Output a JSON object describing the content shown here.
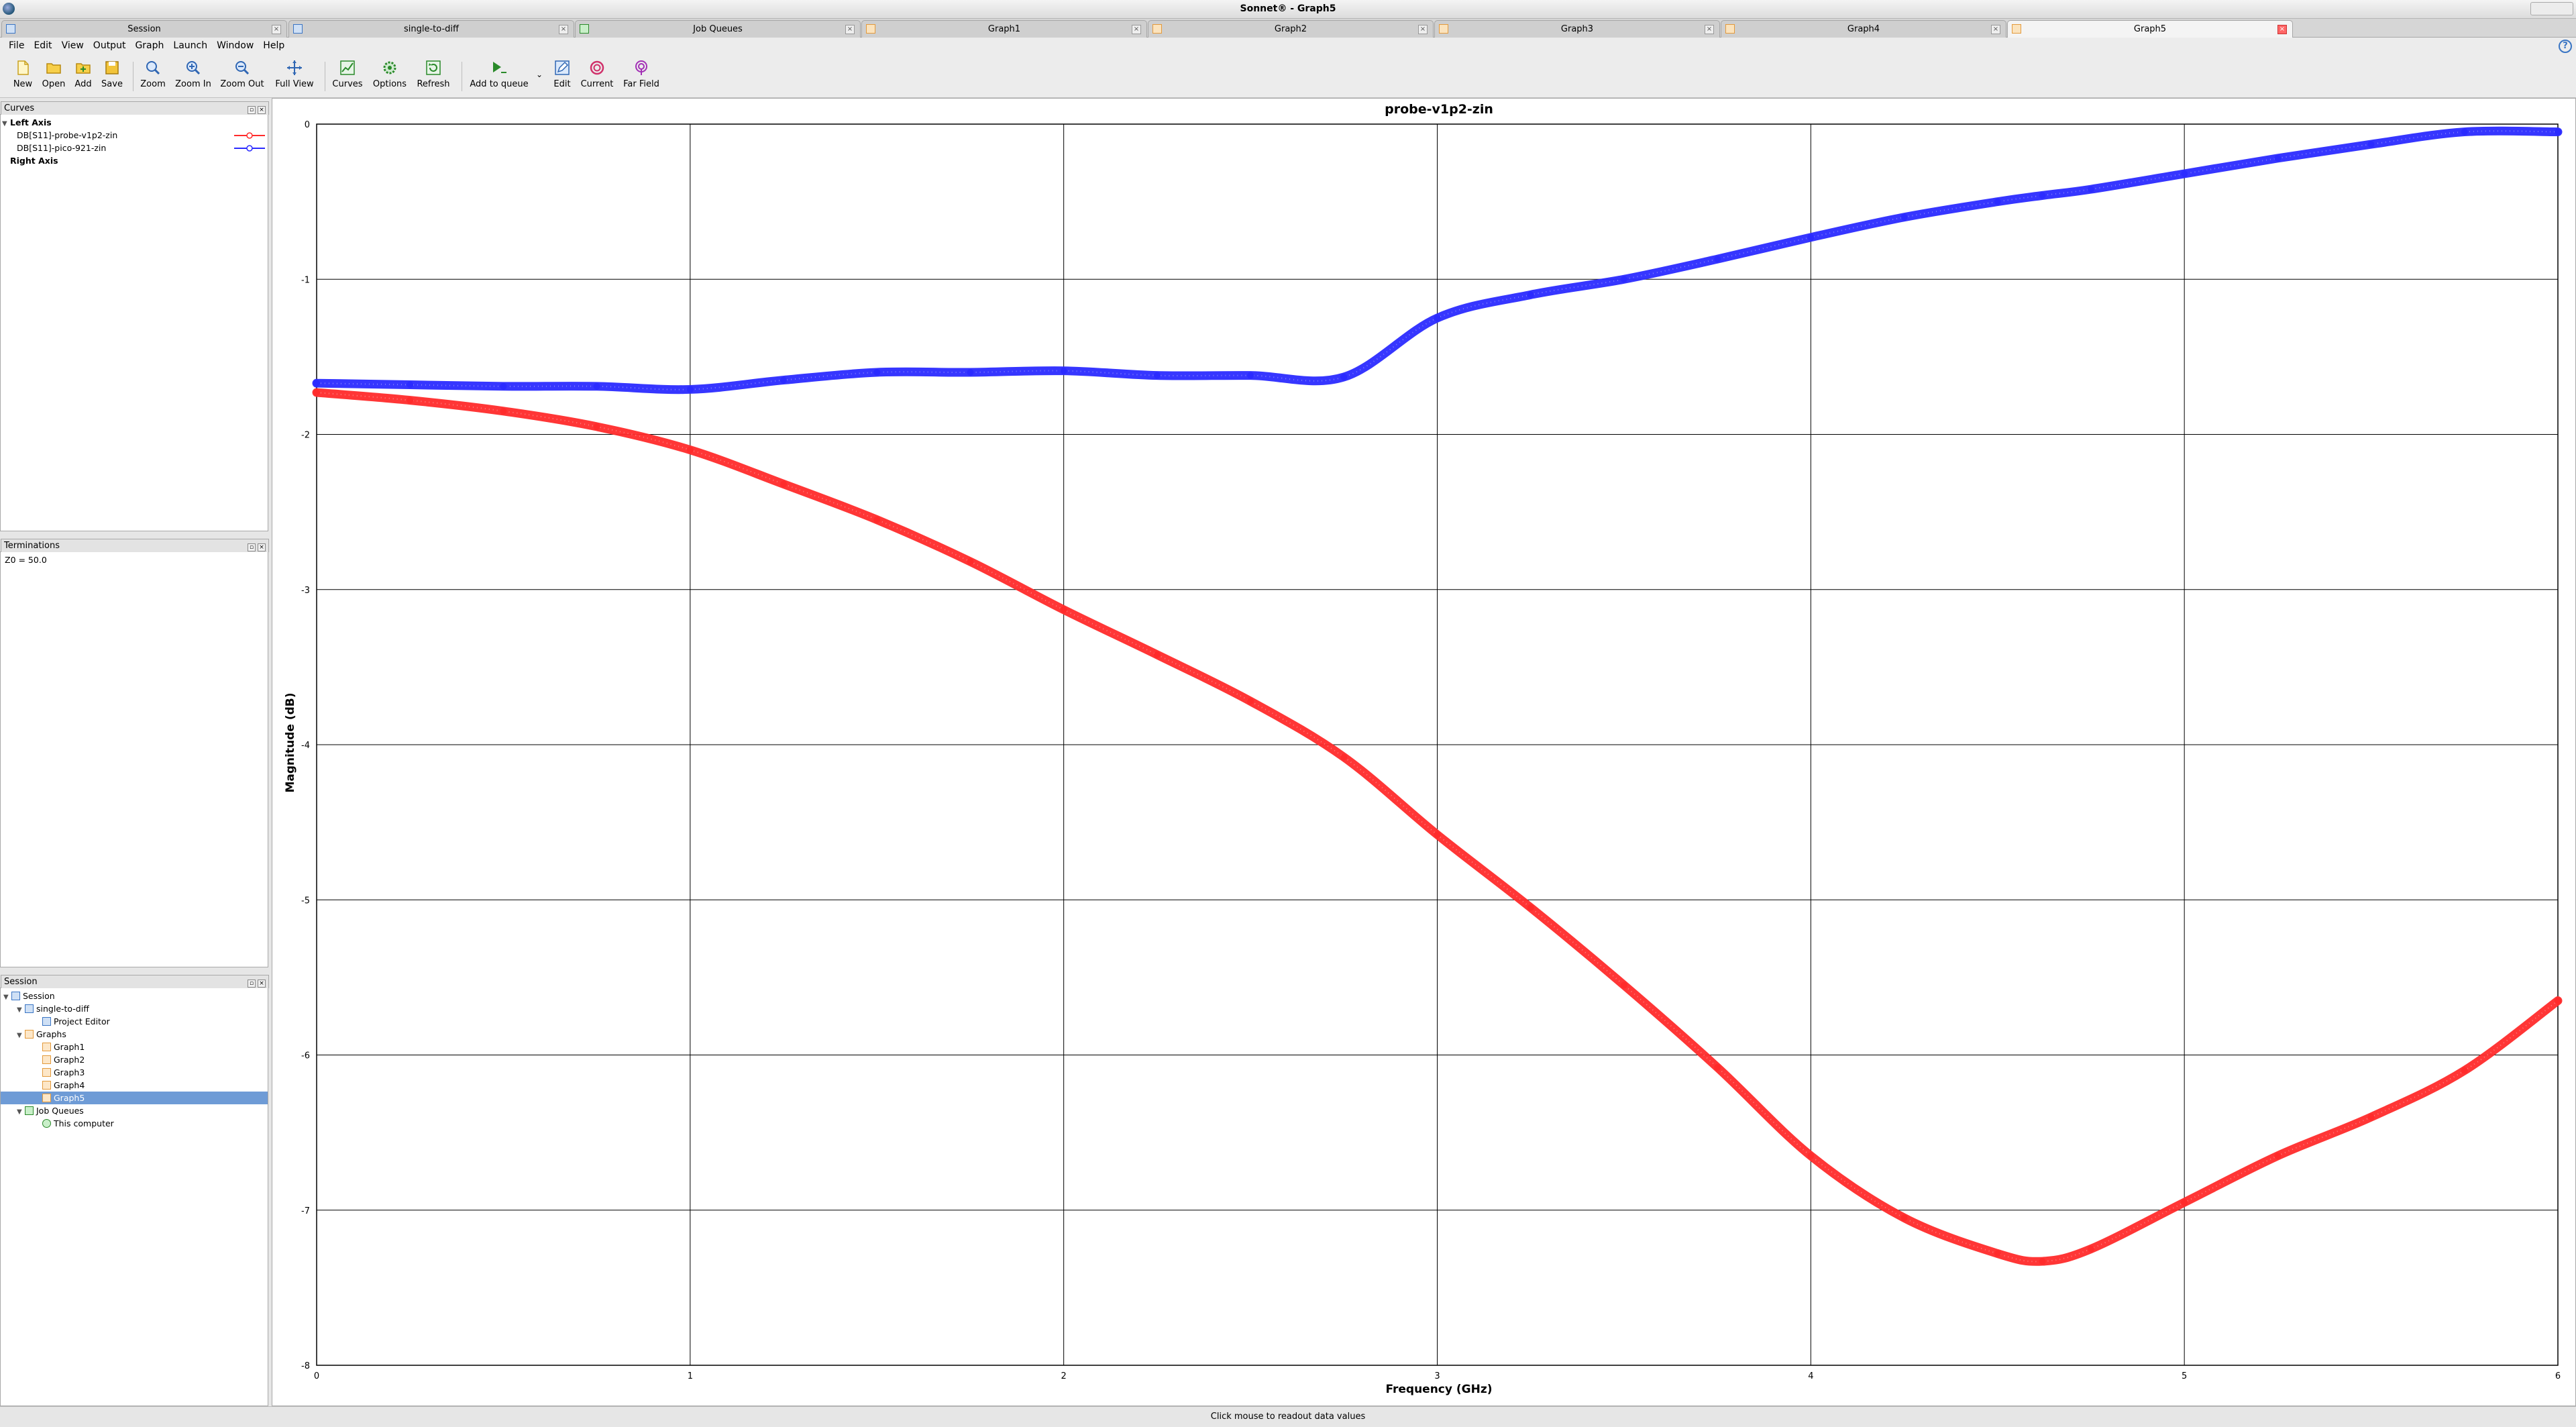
{
  "window": {
    "title": "Sonnet® - Graph5"
  },
  "tabs": [
    {
      "label": "Session",
      "active": false
    },
    {
      "label": "single-to-diff",
      "active": false
    },
    {
      "label": "Job Queues",
      "active": false
    },
    {
      "label": "Graph1",
      "active": false
    },
    {
      "label": "Graph2",
      "active": false
    },
    {
      "label": "Graph3",
      "active": false
    },
    {
      "label": "Graph4",
      "active": false
    },
    {
      "label": "Graph5",
      "active": true
    }
  ],
  "menu": [
    "File",
    "Edit",
    "View",
    "Output",
    "Graph",
    "Launch",
    "Window",
    "Help"
  ],
  "toolbar": {
    "new": "New",
    "open": "Open",
    "add": "Add",
    "save": "Save",
    "zoom": "Zoom",
    "zoom_in": "Zoom In",
    "zoom_out": "Zoom Out",
    "full_view": "Full View",
    "curves": "Curves",
    "options": "Options",
    "refresh": "Refresh",
    "add_to_queue": "Add to queue",
    "edit": "Edit",
    "current": "Current",
    "far_field": "Far Field"
  },
  "curves_panel": {
    "title": "Curves",
    "left_axis": "Left Axis",
    "right_axis": "Right Axis",
    "items": [
      {
        "label": "DB[S11]-probe-v1p2-zin",
        "color": "#ff2b2b"
      },
      {
        "label": "DB[S11]-pico-921-zin",
        "color": "#2b2bff"
      }
    ]
  },
  "terminations_panel": {
    "title": "Terminations",
    "text": "Z0 = 50.0"
  },
  "session_panel": {
    "title": "Session",
    "items": [
      {
        "label": "Session",
        "depth": 0
      },
      {
        "label": "single-to-diff",
        "depth": 1
      },
      {
        "label": "Project Editor",
        "depth": 2
      },
      {
        "label": "Graphs",
        "depth": 1
      },
      {
        "label": "Graph1",
        "depth": 2
      },
      {
        "label": "Graph2",
        "depth": 2
      },
      {
        "label": "Graph3",
        "depth": 2
      },
      {
        "label": "Graph4",
        "depth": 2
      },
      {
        "label": "Graph5",
        "depth": 2,
        "selected": true
      },
      {
        "label": "Job Queues",
        "depth": 1
      },
      {
        "label": "This computer",
        "depth": 2
      }
    ]
  },
  "status": "Click mouse to readout data values",
  "chart_data": {
    "type": "line",
    "title": "probe-v1p2-zin",
    "xlabel": "Frequency (GHz)",
    "ylabel": "Magnitude (dB)",
    "xlim": [
      0,
      6
    ],
    "ylim": [
      -8,
      0
    ],
    "xticks": [
      "0",
      "1",
      "2",
      "3",
      "4",
      "5",
      "6"
    ],
    "yticks": [
      "0",
      "-1",
      "-2",
      "-3",
      "-4",
      "-5",
      "-6",
      "-7",
      "-8"
    ],
    "grid": true,
    "x": [
      0,
      0.25,
      0.5,
      0.75,
      1.0,
      1.25,
      1.5,
      1.75,
      2.0,
      2.25,
      2.5,
      2.75,
      3.0,
      3.25,
      3.5,
      3.75,
      4.0,
      4.25,
      4.5,
      4.62,
      4.75,
      5.0,
      5.25,
      5.5,
      5.75,
      6.0
    ],
    "series": [
      {
        "name": "DB[S11]-probe-v1p2-zin",
        "color": "#ff2b2b",
        "values": [
          -1.73,
          -1.78,
          -1.85,
          -1.95,
          -2.1,
          -2.32,
          -2.55,
          -2.82,
          -3.13,
          -3.42,
          -3.72,
          -4.08,
          -4.58,
          -5.05,
          -5.55,
          -6.08,
          -6.65,
          -7.05,
          -7.28,
          -7.33,
          -7.25,
          -6.95,
          -6.65,
          -6.4,
          -6.1,
          -5.65
        ]
      },
      {
        "name": "DB[S11]-pico-921-zin",
        "color": "#2b2bff",
        "values": [
          -1.67,
          -1.68,
          -1.69,
          -1.69,
          -1.71,
          -1.65,
          -1.6,
          -1.6,
          -1.59,
          -1.62,
          -1.62,
          -1.63,
          -1.25,
          -1.1,
          -1.0,
          -0.87,
          -0.73,
          -0.6,
          -0.5,
          -0.46,
          -0.42,
          -0.32,
          -0.22,
          -0.13,
          -0.05,
          -0.05
        ]
      }
    ]
  }
}
